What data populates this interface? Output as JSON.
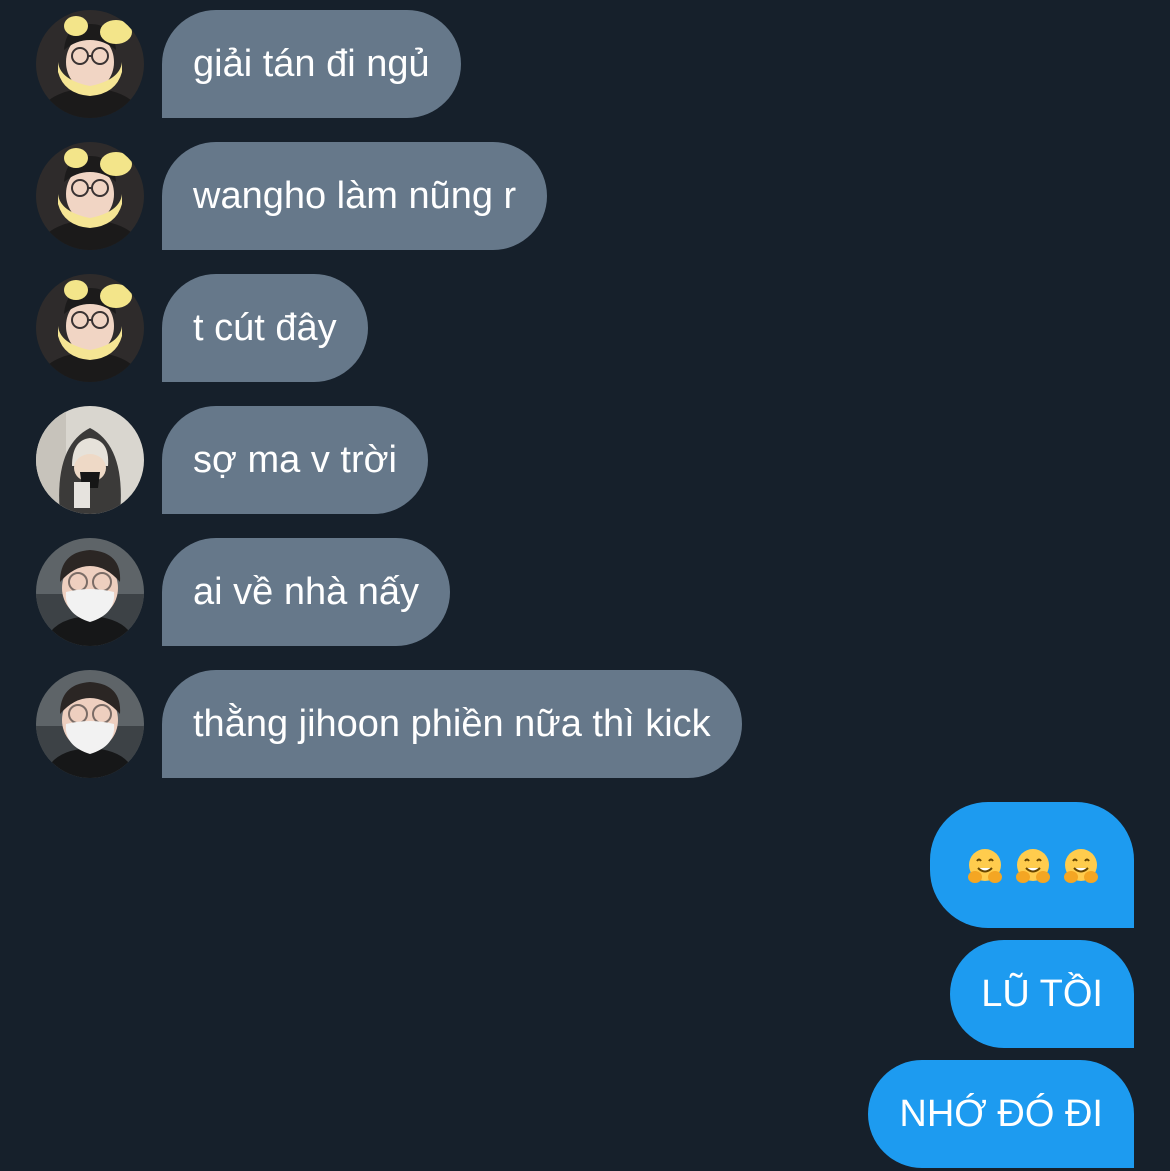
{
  "colors": {
    "background": "#16202b",
    "incoming_bubble": "#66788a",
    "outgoing_bubble": "#1d9bf0",
    "text": "#ffffff"
  },
  "messages_in": [
    {
      "text": "giải tán đi ngủ",
      "avatar": "avatar-yellow-hat-glasses"
    },
    {
      "text": "wangho làm nũng r",
      "avatar": "avatar-yellow-hat-glasses"
    },
    {
      "text": "t cút đây",
      "avatar": "avatar-yellow-hat-glasses"
    },
    {
      "text": "sợ ma v trời",
      "avatar": "avatar-hooded"
    },
    {
      "text": "ai về nhà nấy",
      "avatar": "avatar-mask-glasses"
    },
    {
      "text": "thằng jihoon phiền nữa thì kick",
      "avatar": "avatar-mask-glasses"
    }
  ],
  "messages_out": [
    {
      "emoji": [
        "hugging-face-emoji",
        "hugging-face-emoji",
        "hugging-face-emoji"
      ]
    },
    {
      "text": "LŨ TỒI"
    },
    {
      "text": "NHỚ ĐÓ ĐI"
    }
  ]
}
